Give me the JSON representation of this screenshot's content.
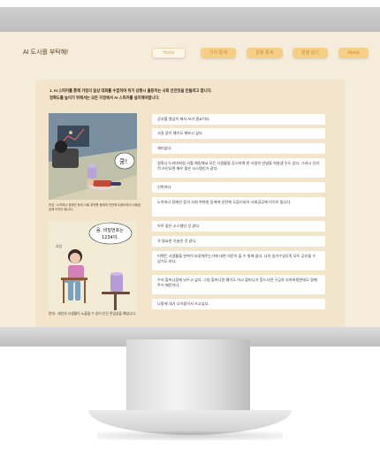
{
  "site": {
    "title": "AI 도시를 부탁해!"
  },
  "nav": [
    {
      "label": "Home"
    },
    {
      "label": "가치 통계"
    },
    {
      "label": "문항 통계"
    },
    {
      "label": "문항 실기"
    },
    {
      "label": "About"
    }
  ],
  "intro": {
    "line1": "1. AI 스피커를 통해 가정의 일상 대화를 수집하여 위기 상황시 출동하는 사회 안전망을 만들려고 합니다.",
    "line2": "정확도를 높이기 위해서는 모든 가정에서 AI 스피커를 설치해야합니다."
  },
  "comics": {
    "panel1": {
      "speech": "쿵!"
    },
    "caption1": "찬성 : 노약자나 장애인 등의 사회 취약층 등에게 안전에 도움이되어 사회공공에 이익이 됩니다.",
    "panel2": {
      "speech": "음. 비밀번호는 1234야.",
      "sfx": "흐음"
    },
    "caption2": "반대 : 개인의 사생활이 노출될 수 있어 인간 존엄성을 해칩니다."
  },
  "answers": [
    "공부를 열심히 해서 AI가 필요이다.",
    "사랑 같이 얘기도 해보고 싶다.",
    "재미없다.",
    "영화나 드라마처럼 사를 해킹해서 모든 사생활을 감시하며 한 사람의 안녕을 박살낼 수도 있다. 그러나 선의적 쓰인다면 매우 좋은 시스템인거 같다.",
    "신박하다.",
    "노약자나 장애인 등의 사회 취약층 등에게 안전에 도움이되어 사회공공에 이익이 됩니다.",
    "아주 좋은 시스템인 것 같다.",
    "꼭 필요한 기술인 것 같다.",
    "어쨋든 사생활을 완벽히 보장해주는가에 대한 의문이 들 수 밖에 없다. 나의 일거수일투족 모두 공유될 수 있기도 하다.",
    "우리 할머니집에 놔두고 싶다. 그럼 할머니랑 얘기도 하고 할머니가 힘드시면 구급차 부처버릴한테도 말해주기 때문이다.",
    "나중에 내가 나이들어서 쓰고싶다."
  ],
  "colors": {
    "page_bg": "#f6ecdc",
    "card_bg": "#f3e4cc",
    "nav_button": "#f6cf86",
    "title_text": "#5a3a1a"
  }
}
